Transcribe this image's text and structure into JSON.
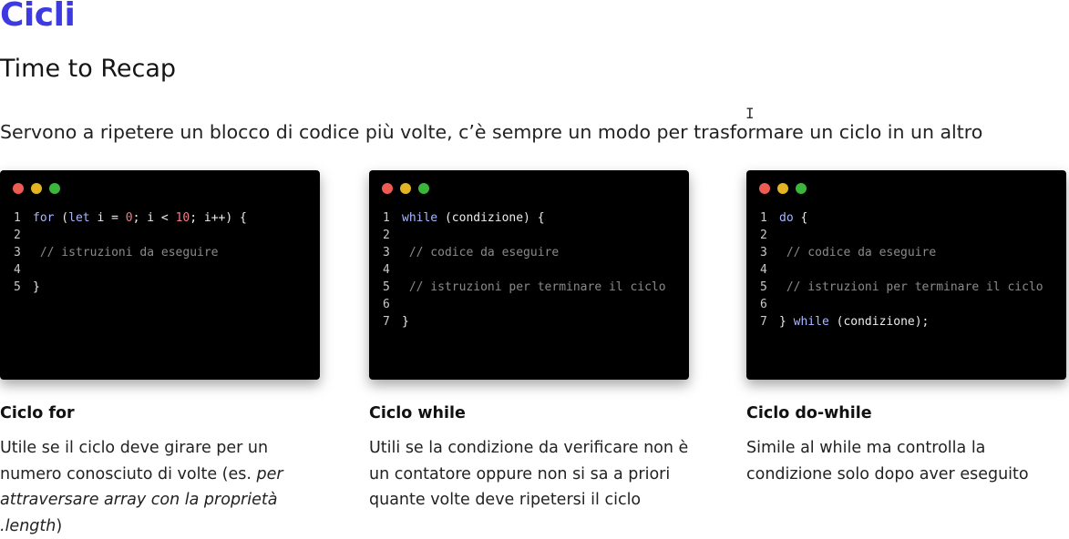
{
  "page": {
    "title": "Cicli",
    "subtitle": "Time to Recap",
    "intro": "Servono a ripetere un blocco di codice più volte, c’è sempre un modo per trasformare un ciclo in un altro",
    "cursor_glyph": "I"
  },
  "colors": {
    "title": "#3d3ae0",
    "card_bg": "#000000",
    "dot_red": "#ed5b52",
    "dot_yellow": "#e3b522",
    "dot_green": "#3cb53c",
    "keyword": "#a9b7ff",
    "number": "#f07a8a",
    "comment": "#8a8a8a"
  },
  "cards": [
    {
      "code": [
        {
          "n": "1",
          "tokens": [
            {
              "t": "kw",
              "v": "for"
            },
            {
              "t": "tx",
              "v": " ("
            },
            {
              "t": "kw",
              "v": "let"
            },
            {
              "t": "tx",
              "v": " i = "
            },
            {
              "t": "num",
              "v": "0"
            },
            {
              "t": "tx",
              "v": "; i < "
            },
            {
              "t": "num",
              "v": "10"
            },
            {
              "t": "tx",
              "v": "; i++) {"
            }
          ]
        },
        {
          "n": "2",
          "tokens": []
        },
        {
          "n": "3",
          "tokens": [
            {
              "t": "cm",
              "v": " // istruzioni da eseguire"
            }
          ]
        },
        {
          "n": "4",
          "tokens": []
        },
        {
          "n": "5",
          "tokens": [
            {
              "t": "tx",
              "v": "}"
            }
          ]
        }
      ],
      "title": "Ciclo for",
      "desc_parts": [
        {
          "t": "plain",
          "v": "Utile se il ciclo deve girare per un numero conosciuto di volte (es. "
        },
        {
          "t": "em",
          "v": "per attraversare array con la proprietà .length"
        },
        {
          "t": "plain",
          "v": ")"
        }
      ]
    },
    {
      "code": [
        {
          "n": "1",
          "tokens": [
            {
              "t": "kw",
              "v": "while"
            },
            {
              "t": "tx",
              "v": " (condizione) {"
            }
          ]
        },
        {
          "n": "2",
          "tokens": []
        },
        {
          "n": "3",
          "tokens": [
            {
              "t": "cm",
              "v": " // codice da eseguire"
            }
          ]
        },
        {
          "n": "4",
          "tokens": []
        },
        {
          "n": "5",
          "tokens": [
            {
              "t": "cm",
              "v": " // istruzioni per terminare il ciclo"
            }
          ]
        },
        {
          "n": "6",
          "tokens": []
        },
        {
          "n": "7",
          "tokens": [
            {
              "t": "tx",
              "v": "}"
            }
          ]
        }
      ],
      "title": "Ciclo while",
      "desc_parts": [
        {
          "t": "plain",
          "v": "Utili se la condizione da verificare non è un contatore oppure non si sa a priori quante volte deve ripetersi il ciclo"
        }
      ]
    },
    {
      "code": [
        {
          "n": "1",
          "tokens": [
            {
              "t": "kw",
              "v": "do"
            },
            {
              "t": "tx",
              "v": " {"
            }
          ]
        },
        {
          "n": "2",
          "tokens": []
        },
        {
          "n": "3",
          "tokens": [
            {
              "t": "cm",
              "v": " // codice da eseguire"
            }
          ]
        },
        {
          "n": "4",
          "tokens": []
        },
        {
          "n": "5",
          "tokens": [
            {
              "t": "cm",
              "v": " // istruzioni per terminare il ciclo"
            }
          ]
        },
        {
          "n": "6",
          "tokens": []
        },
        {
          "n": "7",
          "tokens": [
            {
              "t": "tx",
              "v": "} "
            },
            {
              "t": "kw",
              "v": "while"
            },
            {
              "t": "tx",
              "v": " (condizione);"
            }
          ]
        }
      ],
      "title": "Ciclo do-while",
      "desc_parts": [
        {
          "t": "plain",
          "v": "Simile al while ma controlla la condizione solo dopo aver eseguito"
        }
      ]
    }
  ]
}
